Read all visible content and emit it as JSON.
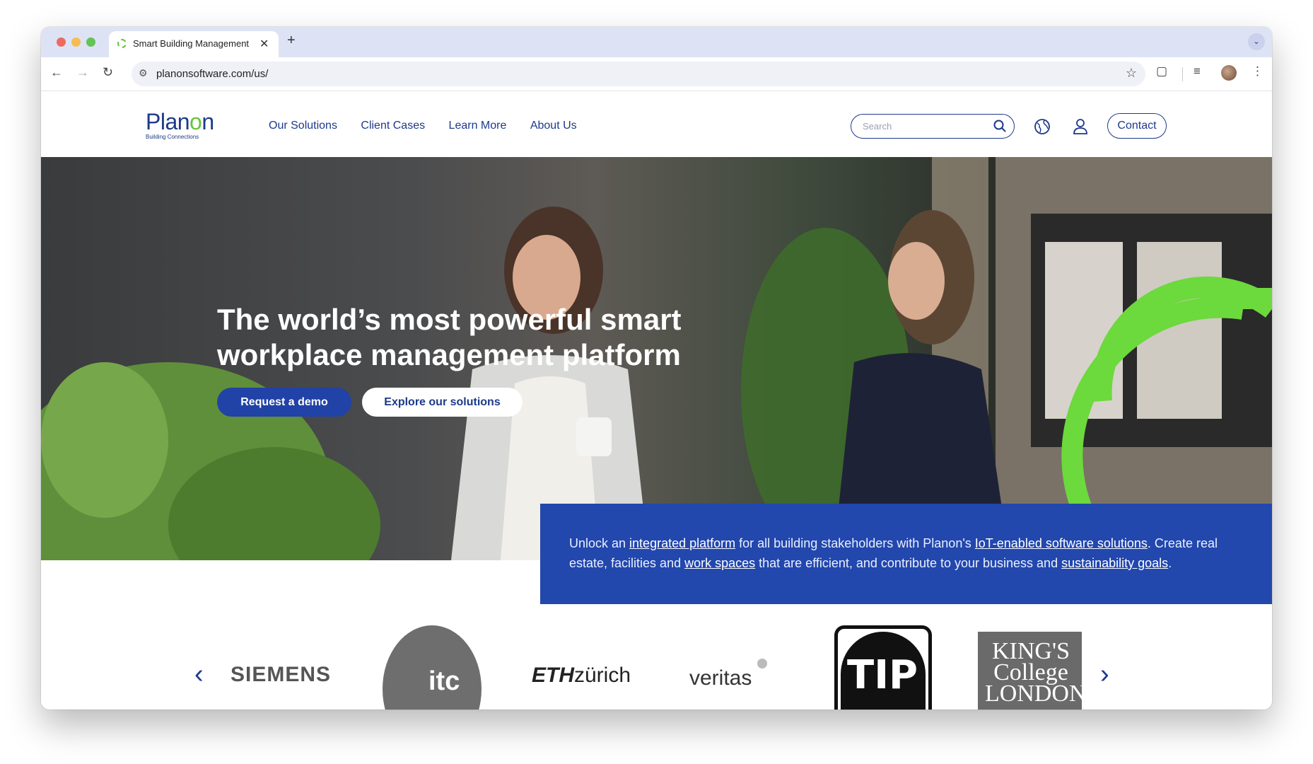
{
  "browser": {
    "tab_title": "Smart Building Management",
    "tab_close": "✕",
    "new_tab": "+",
    "tab_menu": "⌄",
    "url": "planonsoftware.com/us/"
  },
  "header": {
    "logo_text_1": "Plan",
    "logo_text_o": "o",
    "logo_text_2": "n",
    "logo_subtitle": "Building Connections",
    "nav": [
      "Our Solutions",
      "Client Cases",
      "Learn More",
      "About Us"
    ],
    "search_placeholder": "Search",
    "contact_label": "Contact"
  },
  "hero": {
    "title": "The world’s most powerful smart workplace management platform",
    "primary_cta": "Request a demo",
    "secondary_cta": "Explore our solutions"
  },
  "intro": {
    "part1": "Unlock an ",
    "link1": "integrated platform",
    "part2": " for all building stakeholders with Planon's ",
    "link2": "IoT-enabled software solutions",
    "part3": ". Create real estate, facilities and ",
    "link3": "work spaces",
    "part4": " that are efficient, and contribute to your business and ",
    "link4": "sustainability goals",
    "part5": "."
  },
  "clients": {
    "prev": "‹",
    "next": "›",
    "siemens": "SIEMENS",
    "itc": "itc",
    "eth_bold": "ETH",
    "eth_rest": "zürich",
    "veritas": "veritas",
    "tip": "TIP",
    "kings": "KING'S College LONDON"
  },
  "colors": {
    "brand_blue": "#1d3a8a",
    "button_blue": "#2142a6",
    "panel_blue": "#2247ad",
    "brand_green": "#68c33a"
  }
}
